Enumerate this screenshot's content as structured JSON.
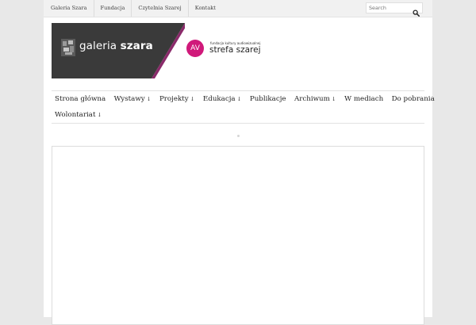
{
  "topbar": {
    "links": [
      "Galeria Szara",
      "Fundacja",
      "Czytelnia Szarej",
      "Kontakt"
    ],
    "search_placeholder": "Search",
    "search_icon": "search-icon"
  },
  "header": {
    "logo_light": "galeria ",
    "logo_bold": "szara",
    "av_badge": "AV",
    "av_subtitle": "fundacja kultury audiowizualnej",
    "av_title": "strefa szarej",
    "colors": {
      "logo_bg": "#3a3a3a",
      "accent": "#d0197a"
    }
  },
  "nav": {
    "row1": [
      {
        "label": "Strona główna",
        "caret": ""
      },
      {
        "label": "Wystawy",
        "caret": "↓"
      },
      {
        "label": "Projekty",
        "caret": "↓"
      },
      {
        "label": "Edukacja",
        "caret": "↓"
      },
      {
        "label": "Publikacje",
        "caret": ""
      },
      {
        "label": "Archiwum",
        "caret": "↓"
      },
      {
        "label": "W mediach",
        "caret": ""
      },
      {
        "label": "Do pobrania",
        "caret": ""
      }
    ],
    "row2": [
      {
        "label": "Wolontariat",
        "caret": "↓"
      }
    ]
  }
}
